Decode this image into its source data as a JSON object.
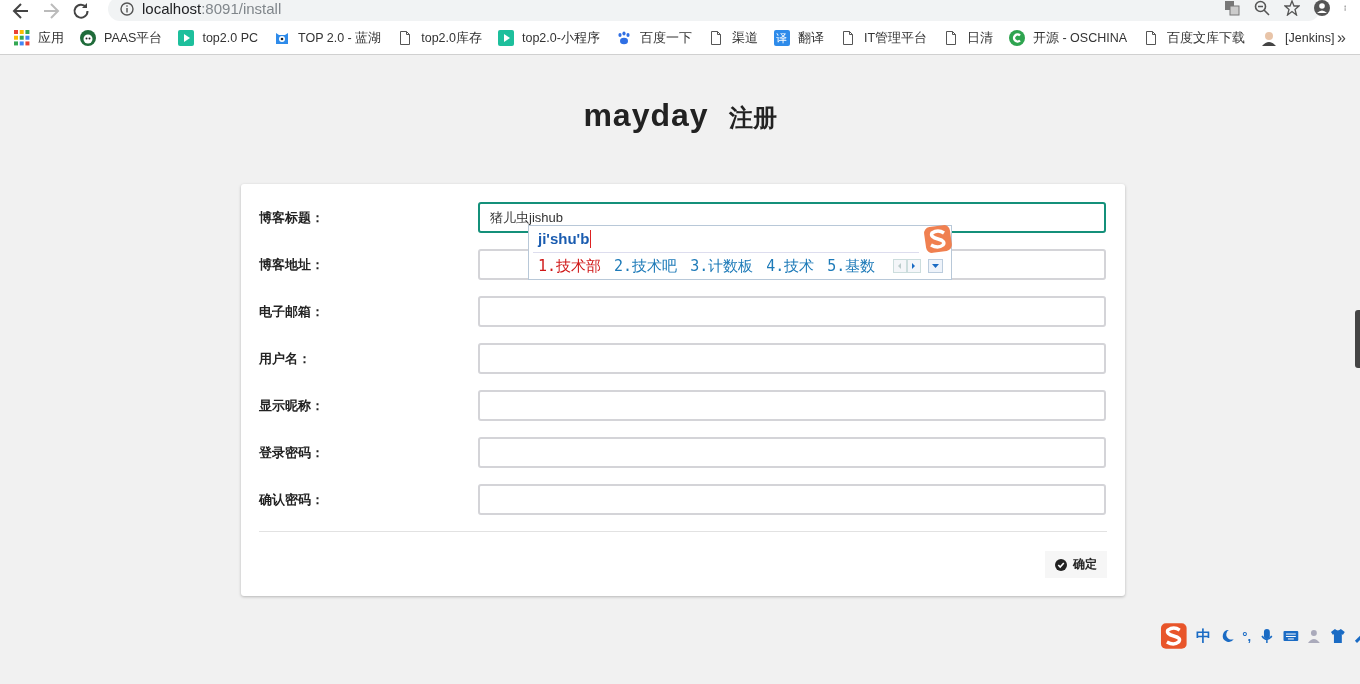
{
  "browser": {
    "url_host": "localhost",
    "url_rest": ":8091/install",
    "bookmarks": [
      {
        "label": "应用",
        "kind": "grid"
      },
      {
        "label": "PAAS平台",
        "kind": "circle"
      },
      {
        "label": "top2.0 PC",
        "kind": "play"
      },
      {
        "label": "TOP 2.0 - 蓝湖",
        "kind": "mascot"
      },
      {
        "label": "top2.0库存",
        "kind": "page"
      },
      {
        "label": "top2.0-小程序",
        "kind": "play"
      },
      {
        "label": "百度一下",
        "kind": "paw"
      },
      {
        "label": "渠道",
        "kind": "page"
      },
      {
        "label": "翻译",
        "kind": "badge",
        "icon_text": "译"
      },
      {
        "label": "IT管理平台",
        "kind": "page"
      },
      {
        "label": "日清",
        "kind": "page"
      },
      {
        "label": "开源 - OSCHINA",
        "kind": "c"
      },
      {
        "label": "百度文库下载",
        "kind": "page"
      },
      {
        "label": "[Jenkins]",
        "kind": "avatar"
      }
    ],
    "more": "»"
  },
  "page": {
    "brand": "mayday",
    "title": "注册"
  },
  "form": {
    "fields": [
      {
        "label": "博客标题：",
        "value": "猪儿虫jishub",
        "focused": true
      },
      {
        "label": "博客地址：",
        "focused": false
      },
      {
        "label": "电子邮箱：",
        "focused": false
      },
      {
        "label": "用户名：",
        "focused": false
      },
      {
        "label": "显示昵称：",
        "focused": false
      },
      {
        "label": "登录密码：",
        "focused": false
      },
      {
        "label": "确认密码：",
        "focused": false
      }
    ],
    "submit": "确定"
  },
  "ime": {
    "composition": "ji'shu'b",
    "candidates": [
      {
        "text": "1.技术部",
        "selected": true
      },
      {
        "text": "2.技术吧",
        "selected": false
      },
      {
        "text": "3.计数板",
        "selected": false
      },
      {
        "text": "4.技术",
        "selected": false
      },
      {
        "text": "5.基数",
        "selected": false
      }
    ]
  },
  "ime_toolbar": {
    "mode": "中",
    "punct": "°,"
  }
}
